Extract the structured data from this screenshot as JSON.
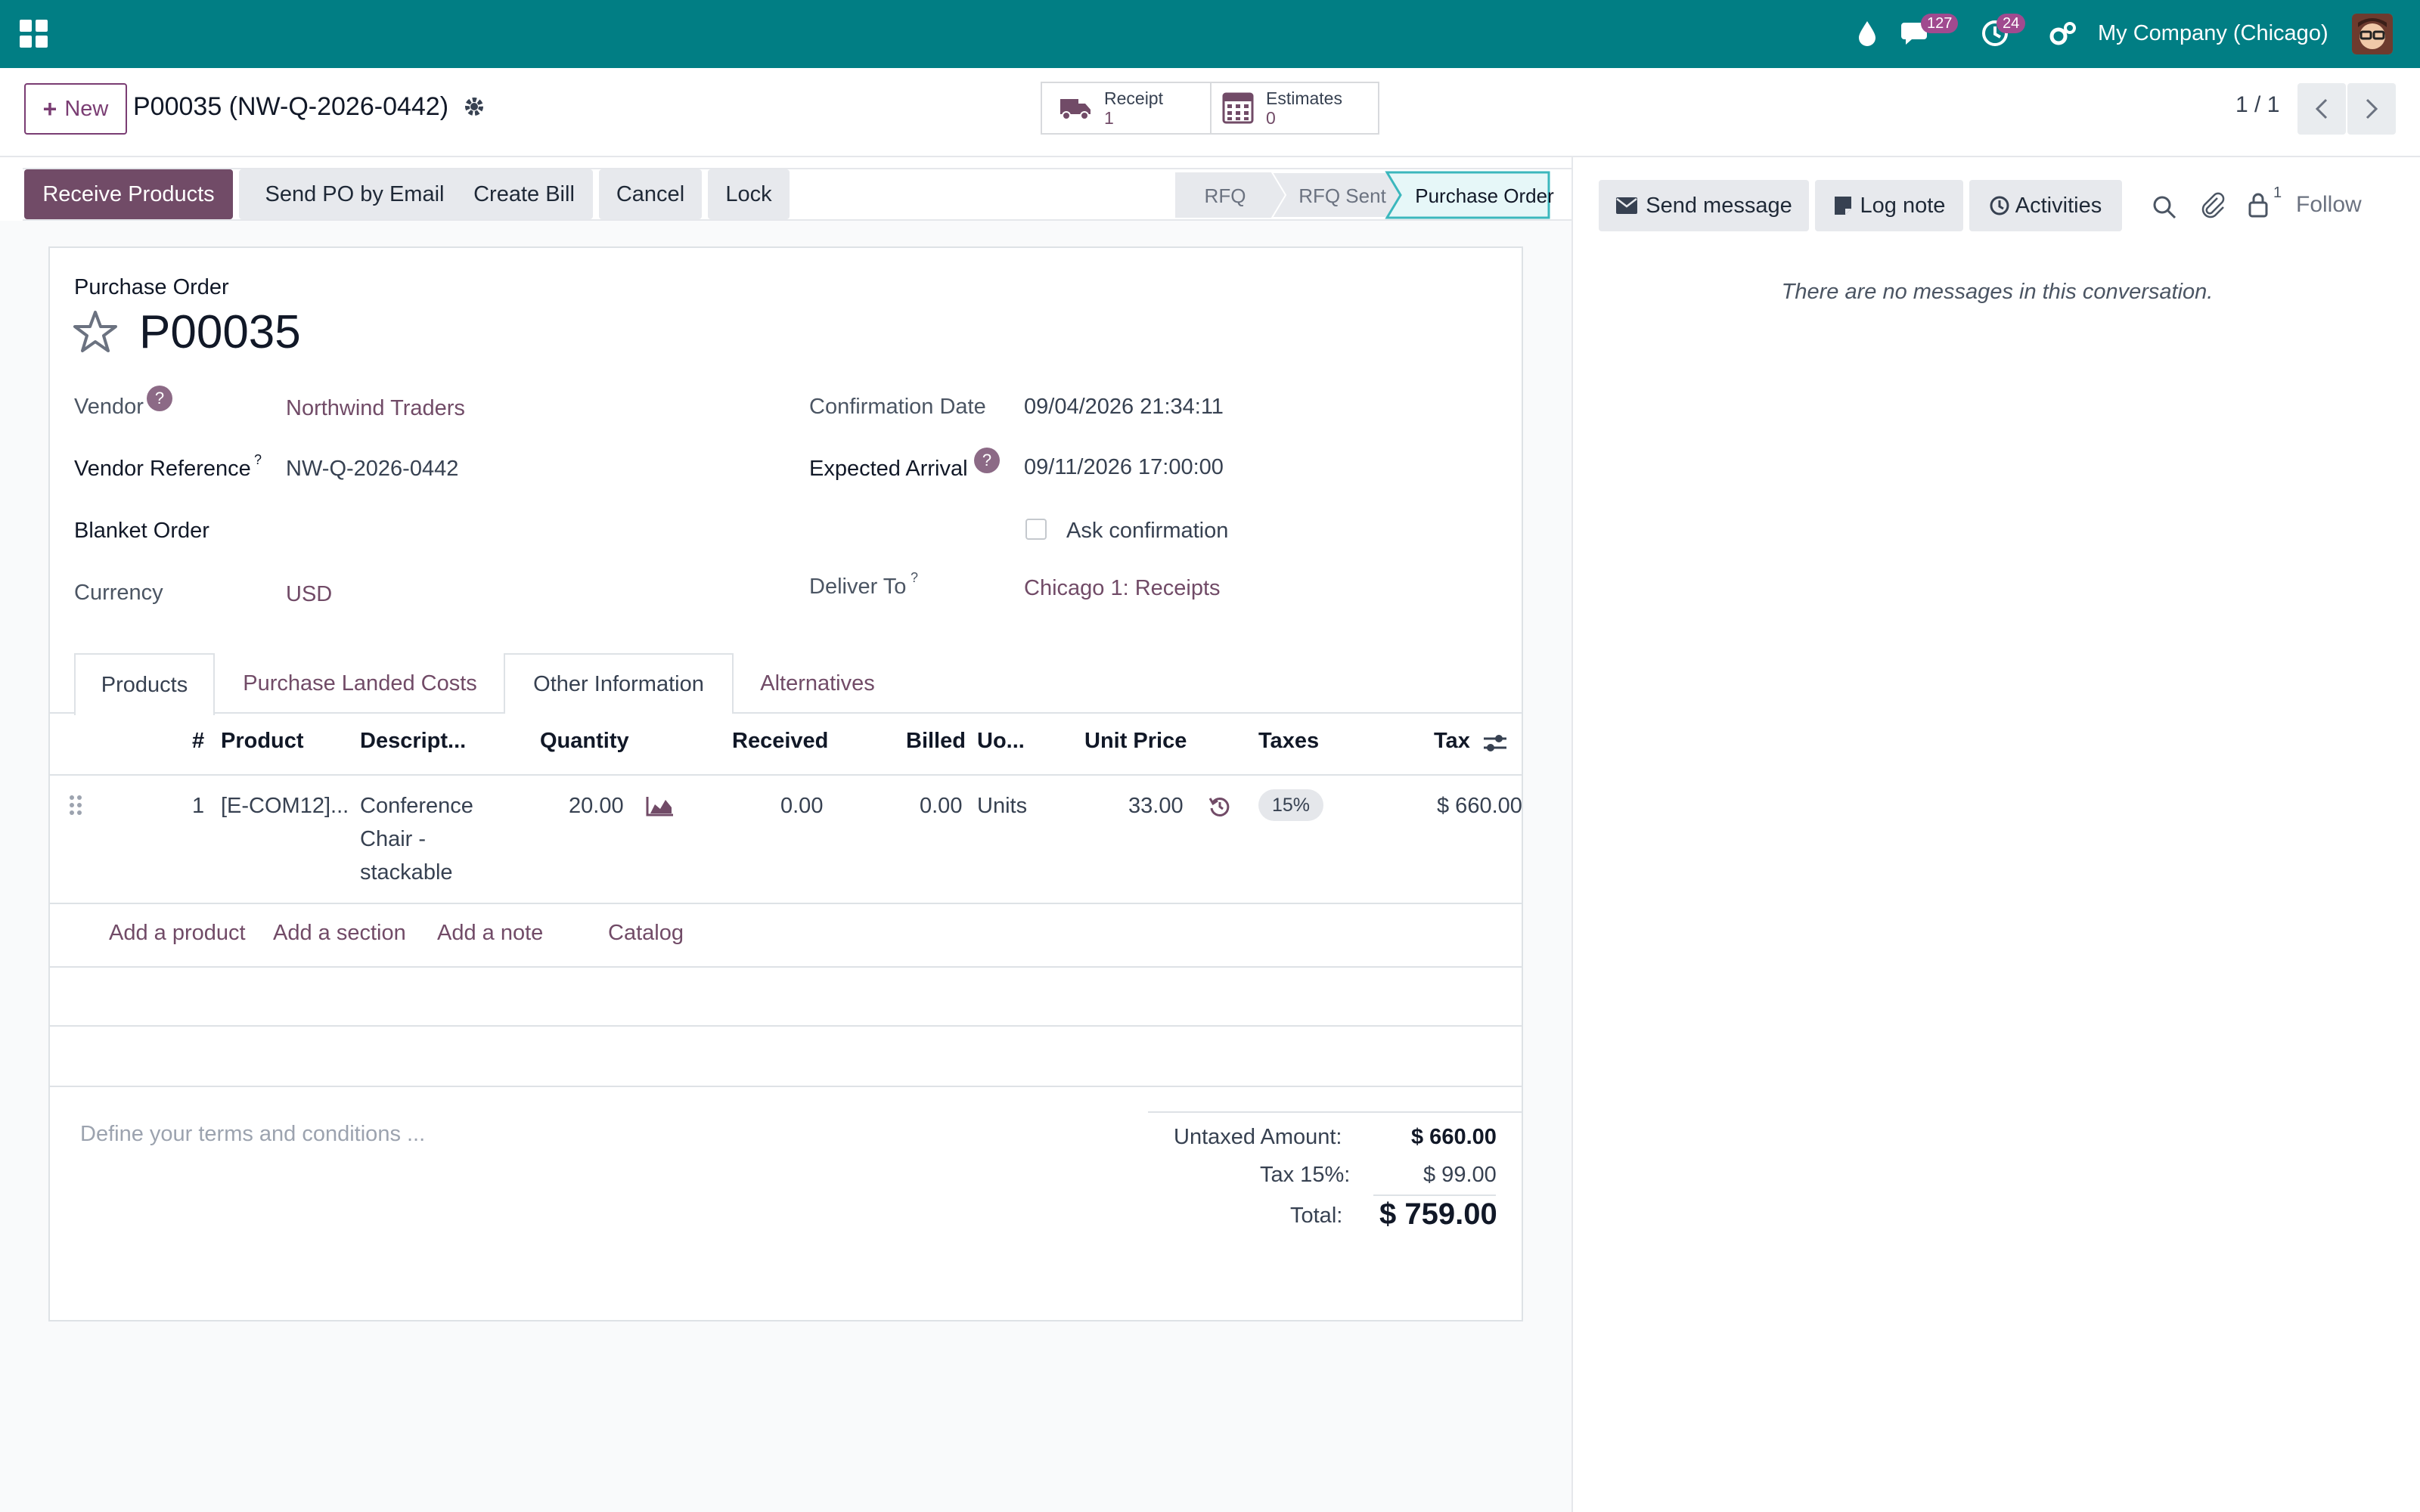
{
  "topbar": {
    "company": "My Company (Chicago)",
    "messages_count": "127",
    "activities_count": "24"
  },
  "control": {
    "new_label": "New",
    "breadcrumb": "P00035 (NW-Q-2026-0442)",
    "smart_buttons": [
      {
        "label": "Receipt",
        "value": "1"
      },
      {
        "label": "Estimates",
        "value": "0"
      }
    ],
    "pager": "1 / 1"
  },
  "status": {
    "buttons": [
      "Receive Products",
      "Send PO by Email",
      "Create Bill",
      "Cancel",
      "Lock"
    ],
    "stages": [
      "RFQ",
      "RFQ Sent",
      "Purchase Order"
    ]
  },
  "form": {
    "type_label": "Purchase Order",
    "name": "P00035",
    "vendor_label": "Vendor",
    "vendor": "Northwind Traders",
    "vendor_ref_label": "Vendor Reference",
    "vendor_ref": "NW-Q-2026-0442",
    "blanket_label": "Blanket Order",
    "currency_label": "Currency",
    "currency": "USD",
    "confirm_date_label": "Confirmation Date",
    "confirm_date": "09/04/2026 21:34:11",
    "arrival_label": "Expected Arrival",
    "arrival": "09/11/2026 17:00:00",
    "ask_confirmation": "Ask confirmation",
    "deliver_to_label": "Deliver To",
    "deliver_to": "Chicago 1: Receipts",
    "qmark": "?"
  },
  "tabs": [
    "Products",
    "Purchase Landed Costs",
    "Other Information",
    "Alternatives"
  ],
  "table": {
    "headers": [
      "#",
      "Product",
      "Descript...",
      "Quantity",
      "Received",
      "Billed",
      "Uo...",
      "Unit Price",
      "Taxes",
      "Tax"
    ],
    "rows": [
      {
        "num": "1",
        "product": "[E-COM12]...",
        "desc_lines": [
          "Conference",
          "Chair -",
          "stackable"
        ],
        "quantity": "20.00",
        "received": "0.00",
        "billed": "0.00",
        "uom": "Units",
        "unit_price": "33.00",
        "taxes": "15%",
        "tax_amount": "$ 660.00"
      }
    ],
    "add_links": [
      "Add a product",
      "Add a section",
      "Add a note",
      "Catalog"
    ]
  },
  "terms_placeholder": "Define your terms and conditions ...",
  "totals": {
    "untaxed_label": "Untaxed Amount:",
    "untaxed": "$ 660.00",
    "tax_label": "Tax 15%:",
    "tax": "$ 99.00",
    "total_label": "Total:",
    "total": "$ 759.00"
  },
  "chatter": {
    "send_message": "Send message",
    "log_note": "Log note",
    "activities": "Activities",
    "followers_count": "1",
    "follow": "Follow",
    "empty": "There are no messages in this conversation."
  },
  "colors": {
    "topbar": "#017e84",
    "primary": "#714b67",
    "active_stage": "#e6f7f8"
  }
}
